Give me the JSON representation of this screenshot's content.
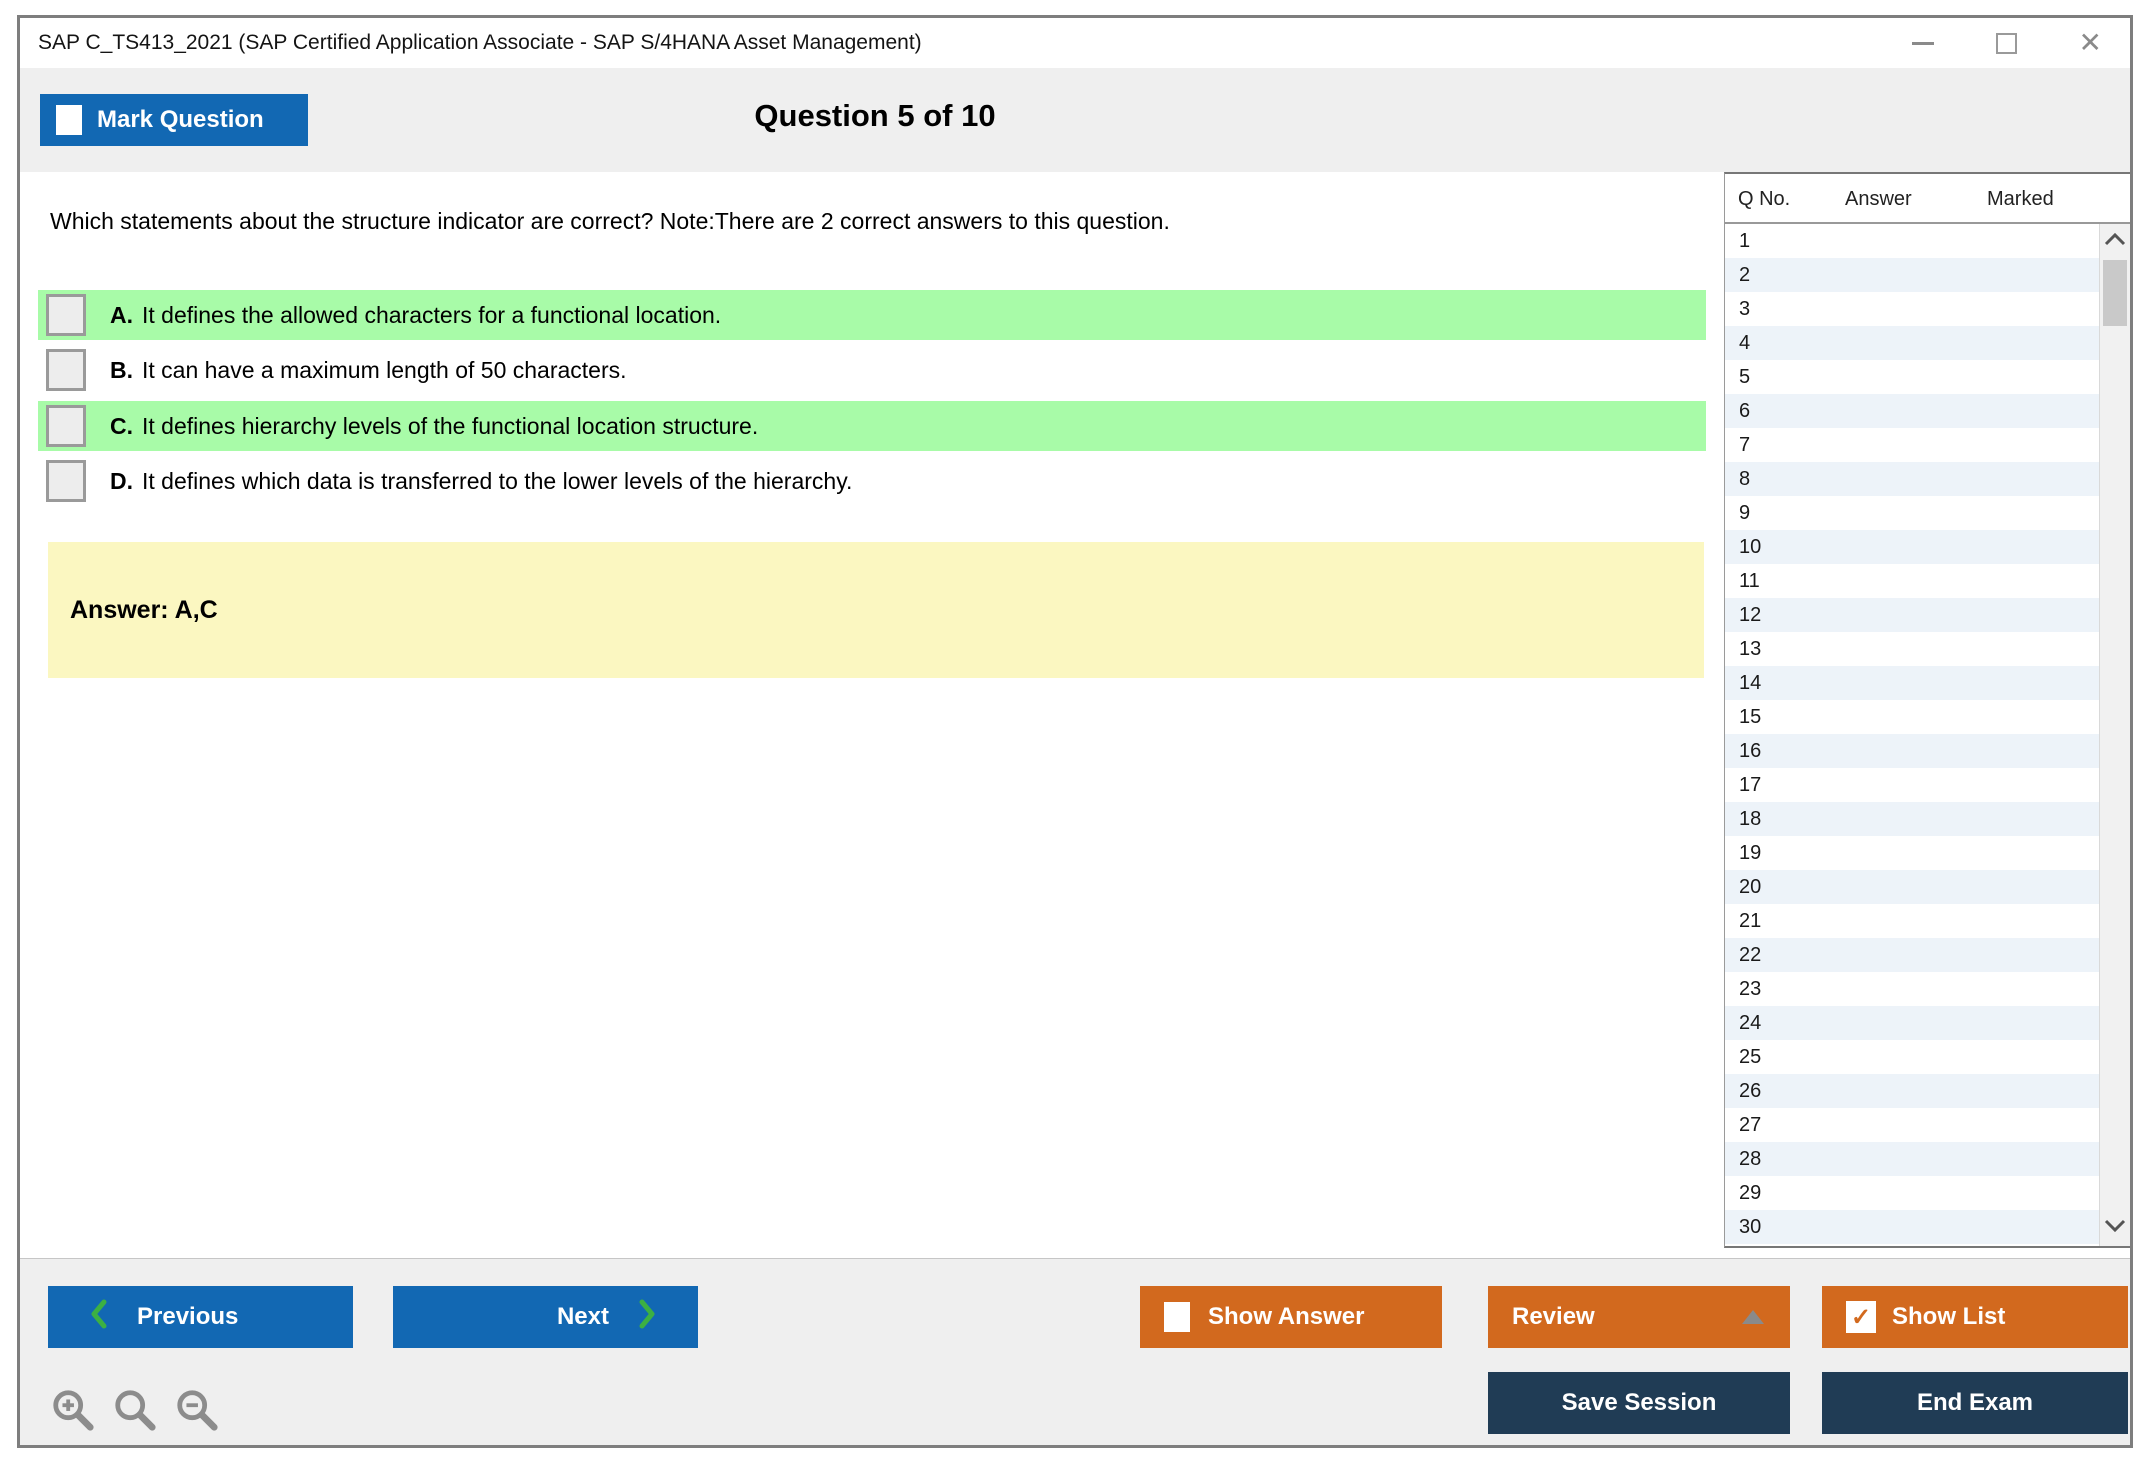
{
  "window": {
    "title": "SAP C_TS413_2021 (SAP Certified Application Associate - SAP S/4HANA Asset Management)"
  },
  "header": {
    "mark_question_label": "Mark Question",
    "question_counter": "Question 5 of 10"
  },
  "question": {
    "text": "Which statements about the structure indicator are correct? Note:There are 2 correct answers to this question.",
    "options": [
      {
        "letter": "A.",
        "text": "It defines the allowed characters for a functional location.",
        "highlighted": true,
        "checked": false
      },
      {
        "letter": "B.",
        "text": "It can have a maximum length of 50 characters.",
        "highlighted": false,
        "checked": false
      },
      {
        "letter": "C.",
        "text": "It defines hierarchy levels of the functional location structure.",
        "highlighted": true,
        "checked": false
      },
      {
        "letter": "D.",
        "text": "It defines which data is transferred to the lower levels of the hierarchy.",
        "highlighted": false,
        "checked": false
      }
    ],
    "answer_label": "Answer: A,C"
  },
  "question_list": {
    "columns": [
      "Q No.",
      "Answer",
      "Marked"
    ],
    "rows": [
      {
        "q_no": "1",
        "answer": "",
        "marked": ""
      },
      {
        "q_no": "2",
        "answer": "",
        "marked": ""
      },
      {
        "q_no": "3",
        "answer": "",
        "marked": ""
      },
      {
        "q_no": "4",
        "answer": "",
        "marked": ""
      },
      {
        "q_no": "5",
        "answer": "",
        "marked": ""
      },
      {
        "q_no": "6",
        "answer": "",
        "marked": ""
      },
      {
        "q_no": "7",
        "answer": "",
        "marked": ""
      },
      {
        "q_no": "8",
        "answer": "",
        "marked": ""
      },
      {
        "q_no": "9",
        "answer": "",
        "marked": ""
      },
      {
        "q_no": "10",
        "answer": "",
        "marked": ""
      },
      {
        "q_no": "11",
        "answer": "",
        "marked": ""
      },
      {
        "q_no": "12",
        "answer": "",
        "marked": ""
      },
      {
        "q_no": "13",
        "answer": "",
        "marked": ""
      },
      {
        "q_no": "14",
        "answer": "",
        "marked": ""
      },
      {
        "q_no": "15",
        "answer": "",
        "marked": ""
      },
      {
        "q_no": "16",
        "answer": "",
        "marked": ""
      },
      {
        "q_no": "17",
        "answer": "",
        "marked": ""
      },
      {
        "q_no": "18",
        "answer": "",
        "marked": ""
      },
      {
        "q_no": "19",
        "answer": "",
        "marked": ""
      },
      {
        "q_no": "20",
        "answer": "",
        "marked": ""
      },
      {
        "q_no": "21",
        "answer": "",
        "marked": ""
      },
      {
        "q_no": "22",
        "answer": "",
        "marked": ""
      },
      {
        "q_no": "23",
        "answer": "",
        "marked": ""
      },
      {
        "q_no": "24",
        "answer": "",
        "marked": ""
      },
      {
        "q_no": "25",
        "answer": "",
        "marked": ""
      },
      {
        "q_no": "26",
        "answer": "",
        "marked": ""
      },
      {
        "q_no": "27",
        "answer": "",
        "marked": ""
      },
      {
        "q_no": "28",
        "answer": "",
        "marked": ""
      },
      {
        "q_no": "29",
        "answer": "",
        "marked": ""
      },
      {
        "q_no": "30",
        "answer": "",
        "marked": ""
      }
    ]
  },
  "footer": {
    "previous_label": "Previous",
    "next_label": "Next",
    "show_answer_label": "Show Answer",
    "review_label": "Review",
    "show_list_label": "Show List",
    "show_list_checked": true,
    "show_answer_checked": false,
    "save_session_label": "Save Session",
    "end_exam_label": "End Exam",
    "check_glyph": "✓",
    "zoom_icons": [
      "zoom-in",
      "zoom",
      "zoom-out"
    ]
  },
  "colors": {
    "accent_blue": "#1268b3",
    "accent_orange": "#d2691e",
    "dark_navy": "#203c55",
    "highlight_green": "#a8fba8",
    "answer_yellow": "#fbf7c1",
    "row_stripe_blue": "#edf3f9",
    "chevron_green": "#3cb043"
  }
}
